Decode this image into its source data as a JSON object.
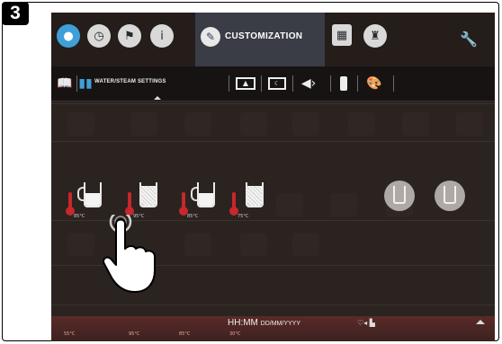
{
  "step_number": "3",
  "top_tabs": [
    {
      "icon": "water-drop-icon"
    },
    {
      "icon": "clock-icon"
    },
    {
      "icon": "flag-icon"
    },
    {
      "icon": "info-icon"
    },
    {
      "icon": "pencil-icon",
      "label": "CUSTOMIZATION",
      "active": true
    },
    {
      "icon": "calculator-icon"
    },
    {
      "icon": "chef-icon"
    },
    {
      "icon": "wrench-icon"
    }
  ],
  "sub_tabs": [
    {
      "icon": "book-icon"
    },
    {
      "icon": "book-blue-icon",
      "label": "WATER/STEAM SETTINGS",
      "active": true
    },
    {
      "icon": "screen-image-icon"
    },
    {
      "icon": "screensaver-icon"
    },
    {
      "icon": "speaker-icon"
    },
    {
      "icon": "bottle-icon"
    },
    {
      "icon": "palette-icon"
    }
  ],
  "temperatures": [
    "85°C",
    "95°C",
    "85°C",
    "75°C"
  ],
  "status": {
    "time": "HH:MM",
    "date": "DD/MM/YYYY"
  },
  "bottom_minis": [
    "55°C",
    "95°C",
    "85°C",
    "30°C"
  ],
  "colors": {
    "active_tab": "#3a3c46",
    "accent_blue": "#3fa0d8",
    "thermo_red": "#c7272d",
    "status_bar": "#5a2a28"
  }
}
